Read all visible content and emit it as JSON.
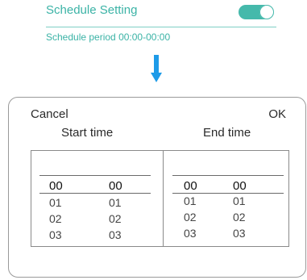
{
  "schedule": {
    "title": "Schedule Setting",
    "toggle_on": true,
    "period_text": "Schedule period 00:00-00:00"
  },
  "colors": {
    "accent": "#3bb3a6",
    "toggle": "#45b9ab",
    "arrow": "#1e9be8"
  },
  "picker": {
    "cancel_label": "Cancel",
    "ok_label": "OK",
    "start_label": "Start time",
    "end_label": "End time",
    "start": {
      "hours": [
        "00",
        "01",
        "02",
        "03"
      ],
      "minutes": [
        "00",
        "01",
        "02",
        "03"
      ]
    },
    "end": {
      "hours": [
        "00",
        "01",
        "02",
        "03"
      ],
      "minutes": [
        "00",
        "01",
        "02",
        "03"
      ]
    }
  }
}
